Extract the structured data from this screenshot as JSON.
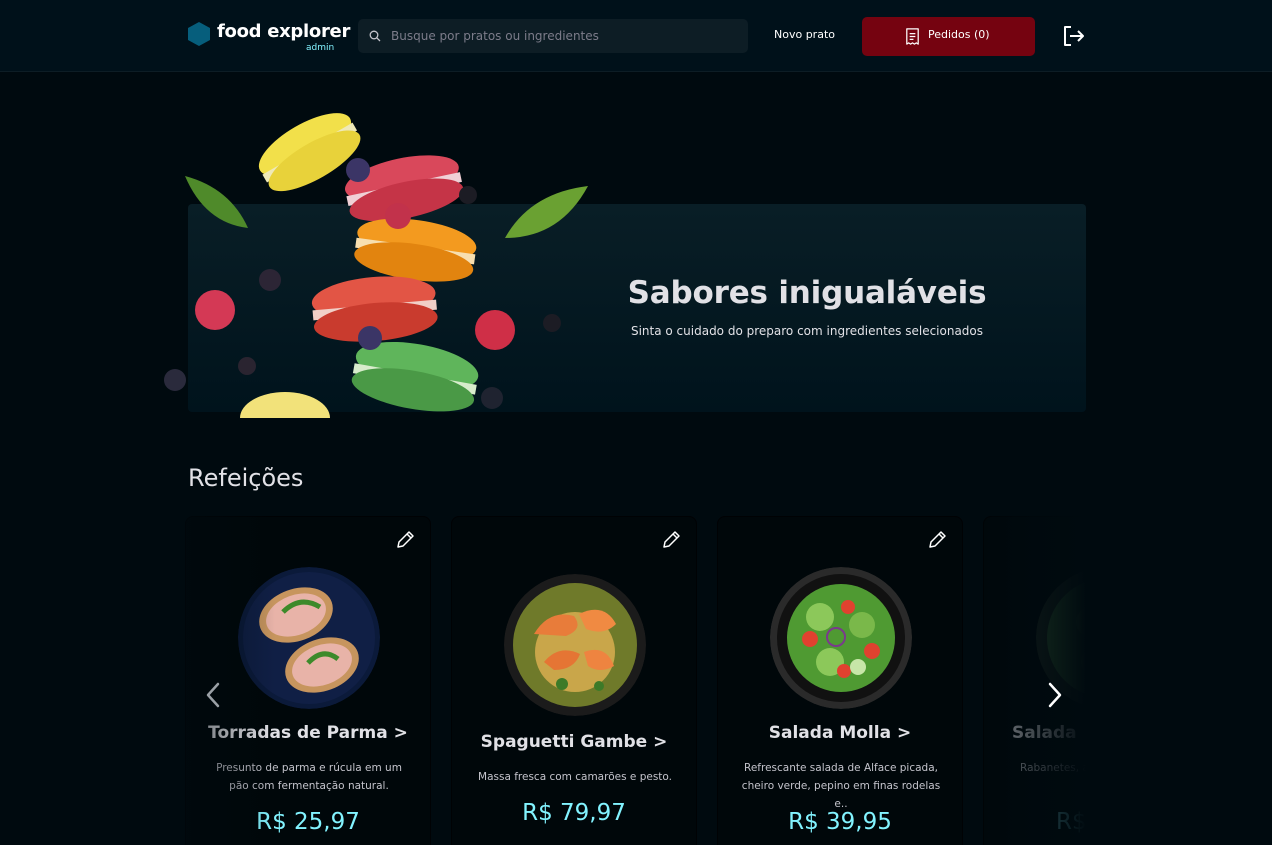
{
  "header": {
    "brand_name": "food explorer",
    "brand_role": "admin",
    "search_placeholder": "Busque por pratos ou ingredientes",
    "new_dish_label": "Novo prato",
    "orders_label": "Pedidos (0)",
    "icons": [
      "hexagon-logo-icon",
      "search-icon",
      "receipt-icon",
      "sign-out-icon"
    ]
  },
  "banner": {
    "title": "Sabores inigualáveis",
    "subtitle": "Sinta o cuidado do preparo com ingredientes selecionados"
  },
  "section": {
    "title": "Refeições",
    "cards": [
      {
        "name": "Torradas de Parma >",
        "description": "Presunto de parma e rúcula em um pão com fermentação natural.",
        "price": "R$ 25,97"
      },
      {
        "name": "Spaguetti Gambe >",
        "description": "Massa fresca com camarões e pesto.",
        "price": "R$ 79,97"
      },
      {
        "name": "Salada Molla >",
        "description": "Refrescante salada de Alface picada, cheiro verde, pepino em finas rodelas e..",
        "price": "R$ 39,95"
      },
      {
        "name": "Salada",
        "description": "Rabanetes, agridoce salp",
        "price": "R$"
      }
    ]
  },
  "colors": {
    "background": "#000a0f",
    "header_bg": "#00111a",
    "accent_red": "#750310",
    "price_cyan": "#82f3ff",
    "brand_blue": "#065e7c"
  }
}
